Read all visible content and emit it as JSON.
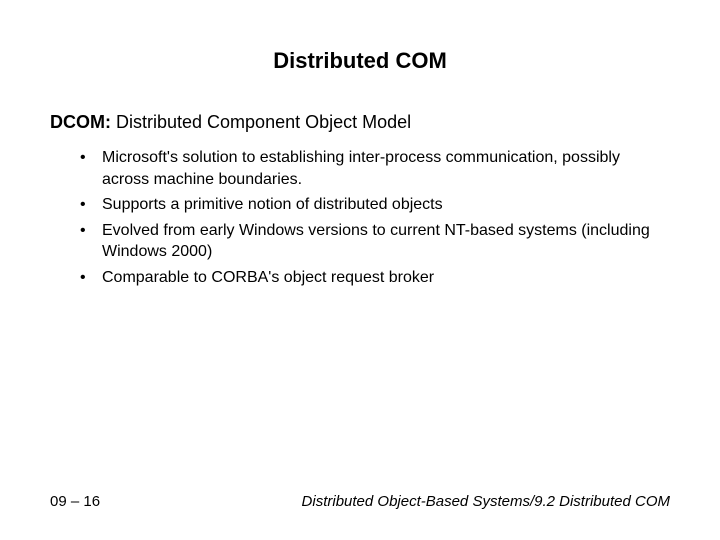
{
  "title": "Distributed COM",
  "subtitle": {
    "label": "DCOM:",
    "expansion": " Distributed Component Object Model"
  },
  "bullets": [
    "Microsoft's solution to establishing inter-process communication, possibly across machine boundaries.",
    "Supports a primitive notion of distributed objects",
    "Evolved from early Windows versions to current NT-based systems (including Windows 2000)",
    "Comparable to CORBA's object request broker"
  ],
  "footer": {
    "left": "09 – 16",
    "right": "Distributed Object-Based Systems/9.2 Distributed COM"
  }
}
